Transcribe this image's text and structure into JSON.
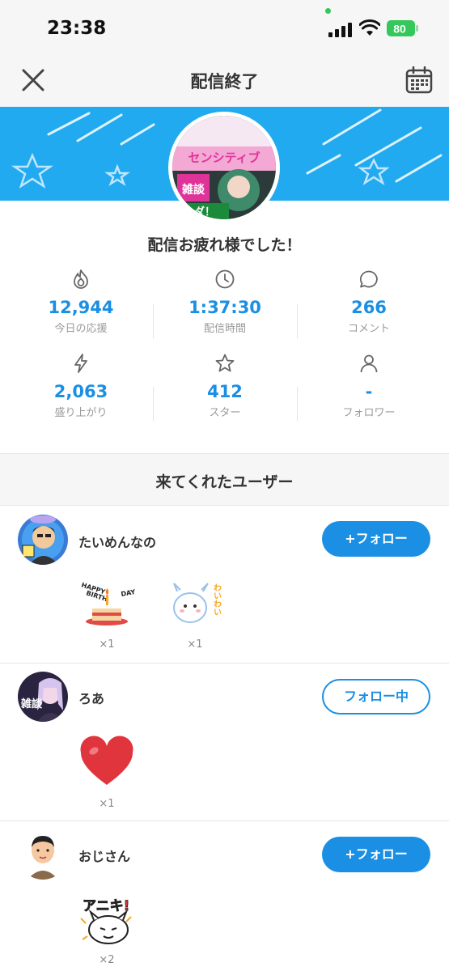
{
  "status_bar": {
    "time": "23:38",
    "battery": "80"
  },
  "nav": {
    "title": "配信終了"
  },
  "greeting": "配信お疲れ様でした！",
  "stats": [
    {
      "icon": "flame-icon",
      "value": "12,944",
      "label": "今日の応援"
    },
    {
      "icon": "clock-icon",
      "value": "1:37:30",
      "label": "配信時間"
    },
    {
      "icon": "comment-icon",
      "value": "266",
      "label": "コメント"
    },
    {
      "icon": "lightning-icon",
      "value": "2,063",
      "label": "盛り上がり"
    },
    {
      "icon": "star-icon",
      "value": "412",
      "label": "スター"
    },
    {
      "icon": "person-icon",
      "value": "-",
      "label": "フォロワー"
    }
  ],
  "avatar_text": {
    "line1": "センシティブ",
    "line2": "雑談",
    "line3": "ダ！"
  },
  "section_title": "来てくれたユーザー",
  "users": [
    {
      "name": "たいめんなの",
      "button": "+フォロー",
      "gifts": [
        {
          "icon": "birthday-cake-gift-icon",
          "count": "×1",
          "caption_top": "HAPPY",
          "caption_mid": "BIRTH",
          "caption_right": "DAY"
        },
        {
          "icon": "dragon-waiwai-gift-icon",
          "count": "×1",
          "caption": "わいわい"
        }
      ]
    },
    {
      "name": "ろあ",
      "button": "フォロー中",
      "avatar_text": "雑談",
      "gifts": [
        {
          "icon": "heart-gift-icon",
          "count": "×1"
        }
      ]
    },
    {
      "name": "おじさん",
      "button": "+フォロー",
      "gifts": [
        {
          "icon": "aniki-gift-icon",
          "count": "×2",
          "caption": "アニキ!"
        }
      ]
    }
  ],
  "colors": {
    "accent": "#1a8fe3",
    "banner": "#22aaf0",
    "bar_bg": "#f6f6f7"
  }
}
